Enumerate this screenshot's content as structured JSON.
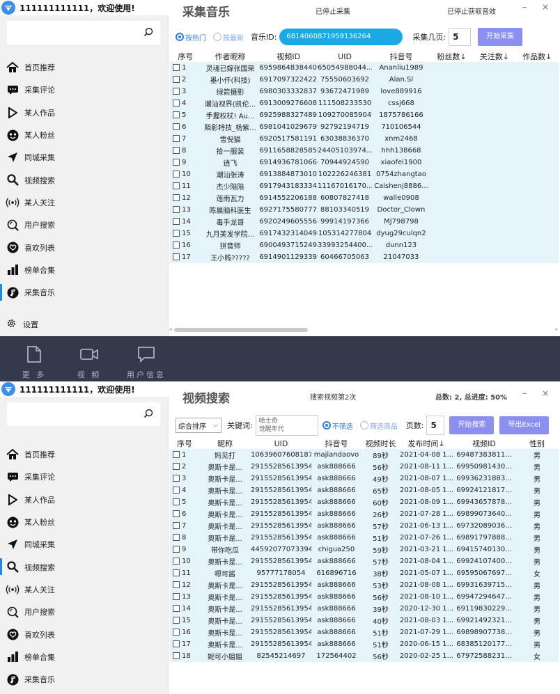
{
  "window1": {
    "welcome": "111111111111，欢迎使用!",
    "title": "采集音乐",
    "status_left": "已停止采集",
    "status_right": "已停止获取音效",
    "minimize": "–",
    "close": "×",
    "toolbar": {
      "radio_hot": "按热门",
      "radio_new": "按最新",
      "music_id_label": "音乐ID:",
      "music_id_value": "6814060871959136264",
      "pages_label": "采集几页:",
      "pages_value": "5",
      "start_button": "开始采集"
    },
    "columns": [
      "序号",
      "作者昵称",
      "视频ID",
      "UID",
      "抖音号",
      "粉丝数↓",
      "关注数↓",
      "作品数↓"
    ],
    "rows": [
      [
        "1",
        "灵魂已嫁张国荣",
        "69598648384409...",
        "65054988044...",
        "Ananliu1989"
      ],
      [
        "2",
        "墨小仟(科技)",
        "69170973224223...",
        "75550603692",
        "Alan.Sl"
      ],
      [
        "3",
        "绿箭摄影",
        "69803033328375...",
        "93672471989",
        "love889916"
      ],
      [
        "4",
        "潮汕视界(凯伦...",
        "69130092766089...",
        "111508233530",
        "cssj668"
      ],
      [
        "5",
        "手握权杖! Au...",
        "69259883274892...",
        "109270085904",
        "1875786166"
      ],
      [
        "6",
        "陌影特技_杨紫...",
        "69810410296799...",
        "92792194719",
        "710106544"
      ],
      [
        "7",
        "雪倪猫",
        "69205175811912...",
        "63038836370",
        "xnm2468"
      ],
      [
        "8",
        "拾一服装",
        "69116588285850...",
        "24405103974...",
        "hhh138668"
      ],
      [
        "9",
        "逍飞",
        "69149367810666...",
        "70944924590",
        "xiaofei1900"
      ],
      [
        "10",
        "潮汕张涛",
        "69138848730107...",
        "102226246381",
        "0754zhangtao"
      ],
      [
        "11",
        "杰少陪陪",
        "69179431833348...",
        "11167016170...",
        "Caishenj8886..."
      ],
      [
        "12",
        "莲雨瓦力",
        "69145522061883...",
        "60807827418",
        "walle0908"
      ],
      [
        "13",
        "陈晨脑科医生",
        "69271755807775...",
        "88103340519",
        "Doctor_Clown"
      ],
      [
        "14",
        "毒手龙哥",
        "69202496055568...",
        "99914197366",
        "MJ798798"
      ],
      [
        "15",
        "九月美发学院...",
        "69174323140498...",
        "105314277804",
        "dyug29culqn2"
      ],
      [
        "16",
        "拼音师",
        "69004937152494...",
        "33993254400...",
        "dunn123"
      ],
      [
        "17",
        "王小贱?????",
        "69149011293399...",
        "60466705063",
        "21047033"
      ]
    ]
  },
  "sidebar": {
    "items": [
      {
        "label": "首页推荐",
        "icon": "home-icon"
      },
      {
        "label": "采集评论",
        "icon": "comment-icon"
      },
      {
        "label": "某人作品",
        "icon": "play-icon"
      },
      {
        "label": "某人粉丝",
        "icon": "fans-icon"
      },
      {
        "label": "同城采集",
        "icon": "location-arrow-icon"
      },
      {
        "label": "视频搜索",
        "icon": "search-icon"
      },
      {
        "label": "某人关注",
        "icon": "broadcast-icon"
      },
      {
        "label": "用户搜索",
        "icon": "user-search-icon"
      },
      {
        "label": "喜欢列表",
        "icon": "heart-icon"
      },
      {
        "label": "榜单合集",
        "icon": "bar-chart-icon"
      },
      {
        "label": "采集音乐",
        "icon": "music-icon"
      }
    ],
    "settings": "设置"
  },
  "taskbar": {
    "items": [
      {
        "label": "更 多",
        "icon": "document-icon"
      },
      {
        "label": "视 频",
        "icon": "video-icon"
      },
      {
        "label": "用户信息",
        "icon": "message-icon"
      }
    ]
  },
  "window2": {
    "welcome": "111111111111，欢迎使用!",
    "title": "视频搜索",
    "status_mid": "搜索视频第2次",
    "status_right": "总数: 2, 总进度: 50%",
    "minimize": "–",
    "close": "×",
    "toolbar": {
      "sort_value": "综合排序",
      "keyword_label": "关键词:",
      "keyword_line1": "哈士奇",
      "keyword_line2": "觉醒年代",
      "radio_nofilter": "不筛选",
      "radio_goods": "筛选商品",
      "pages_label": "页数:",
      "pages_value": "5",
      "start_button": "开始搜索",
      "export_button": "导出Excel"
    },
    "columns": [
      "序号",
      "昵称",
      "UID",
      "抖音号",
      "视频时长",
      "发布时间↓",
      "视频ID",
      "性别"
    ],
    "rows": [
      [
        "1",
        "妈见打",
        "10639607608187...",
        "majiandaovo",
        "89秒",
        "2021-04-08 1...",
        "69487383811...",
        "男"
      ],
      [
        "2",
        "奥斯卡是...",
        "29155285613954...",
        "ask888666",
        "56秒",
        "2021-08-11 1...",
        "69950981430...",
        "男"
      ],
      [
        "3",
        "奥斯卡是...",
        "29155285613954...",
        "ask888666",
        "49秒",
        "2021-08-07 1...",
        "69936231883...",
        "男"
      ],
      [
        "4",
        "奥斯卡是...",
        "29155285613954...",
        "ask888666",
        "65秒",
        "2021-08-05 1...",
        "69924121817...",
        "男"
      ],
      [
        "5",
        "奥斯卡是...",
        "29155285613954...",
        "ask888666",
        "60秒",
        "2021-08-09 1...",
        "69943657878...",
        "男"
      ],
      [
        "6",
        "奥斯卡是...",
        "29155285613954...",
        "ask888666",
        "26秒",
        "2021-07-28 1...",
        "69899073640...",
        "男"
      ],
      [
        "7",
        "奥斯卡是...",
        "29155285613954...",
        "ask888666",
        "57秒",
        "2021-06-13 1...",
        "69732089036...",
        "男"
      ],
      [
        "8",
        "奥斯卡是...",
        "29155285613954...",
        "ask888666",
        "51秒",
        "2021-07-26 1...",
        "69891797888...",
        "男"
      ],
      [
        "9",
        "带你吃瓜",
        "44592077073394...",
        "chigua250",
        "59秒",
        "2021-03-21 1...",
        "69415740130...",
        "男"
      ],
      [
        "10",
        "奥斯卡是...",
        "29155285613954...",
        "ask888666",
        "57秒",
        "2021-08-04 1...",
        "69924107400...",
        "男"
      ],
      [
        "11",
        "嗯可酱",
        "95777178054",
        "616896716",
        "38秒",
        "2021-05-07 1...",
        "69595067697...",
        "女"
      ],
      [
        "12",
        "奥斯卡是...",
        "29155285613954...",
        "ask888666",
        "53秒",
        "2021-08-08 1...",
        "69931639715...",
        "男"
      ],
      [
        "13",
        "奥斯卡是...",
        "29155285613954...",
        "ask888666",
        "56秒",
        "2021-08-10 1...",
        "69947294647...",
        "男"
      ],
      [
        "14",
        "奥斯卡是...",
        "29155285613954...",
        "ask888666",
        "39秒",
        "2020-12-30 1...",
        "69119830229...",
        "男"
      ],
      [
        "15",
        "奥斯卡是...",
        "29155285613954...",
        "ask888666",
        "40秒",
        "2021-08-03 1...",
        "69921492321...",
        "男"
      ],
      [
        "16",
        "奥斯卡是...",
        "29155285613954...",
        "ask888666",
        "51秒",
        "2021-07-29 1...",
        "69898907738...",
        "男"
      ],
      [
        "17",
        "奥斯卡是...",
        "29155285613954...",
        "ask888666",
        "51秒",
        "2020-06-15 1...",
        "68385120177...",
        "男"
      ],
      [
        "18",
        "妮可小姐姐",
        "82545214697",
        "172564402",
        "56秒",
        "2020-02-25 1...",
        "67972588231...",
        "女"
      ]
    ]
  },
  "colors": {
    "accent": "#1e88e5",
    "row_bg": "#e5f4fb",
    "button": "#8c8ff2",
    "pill": "#1aa9e6",
    "taskbar": "#343a4a"
  }
}
